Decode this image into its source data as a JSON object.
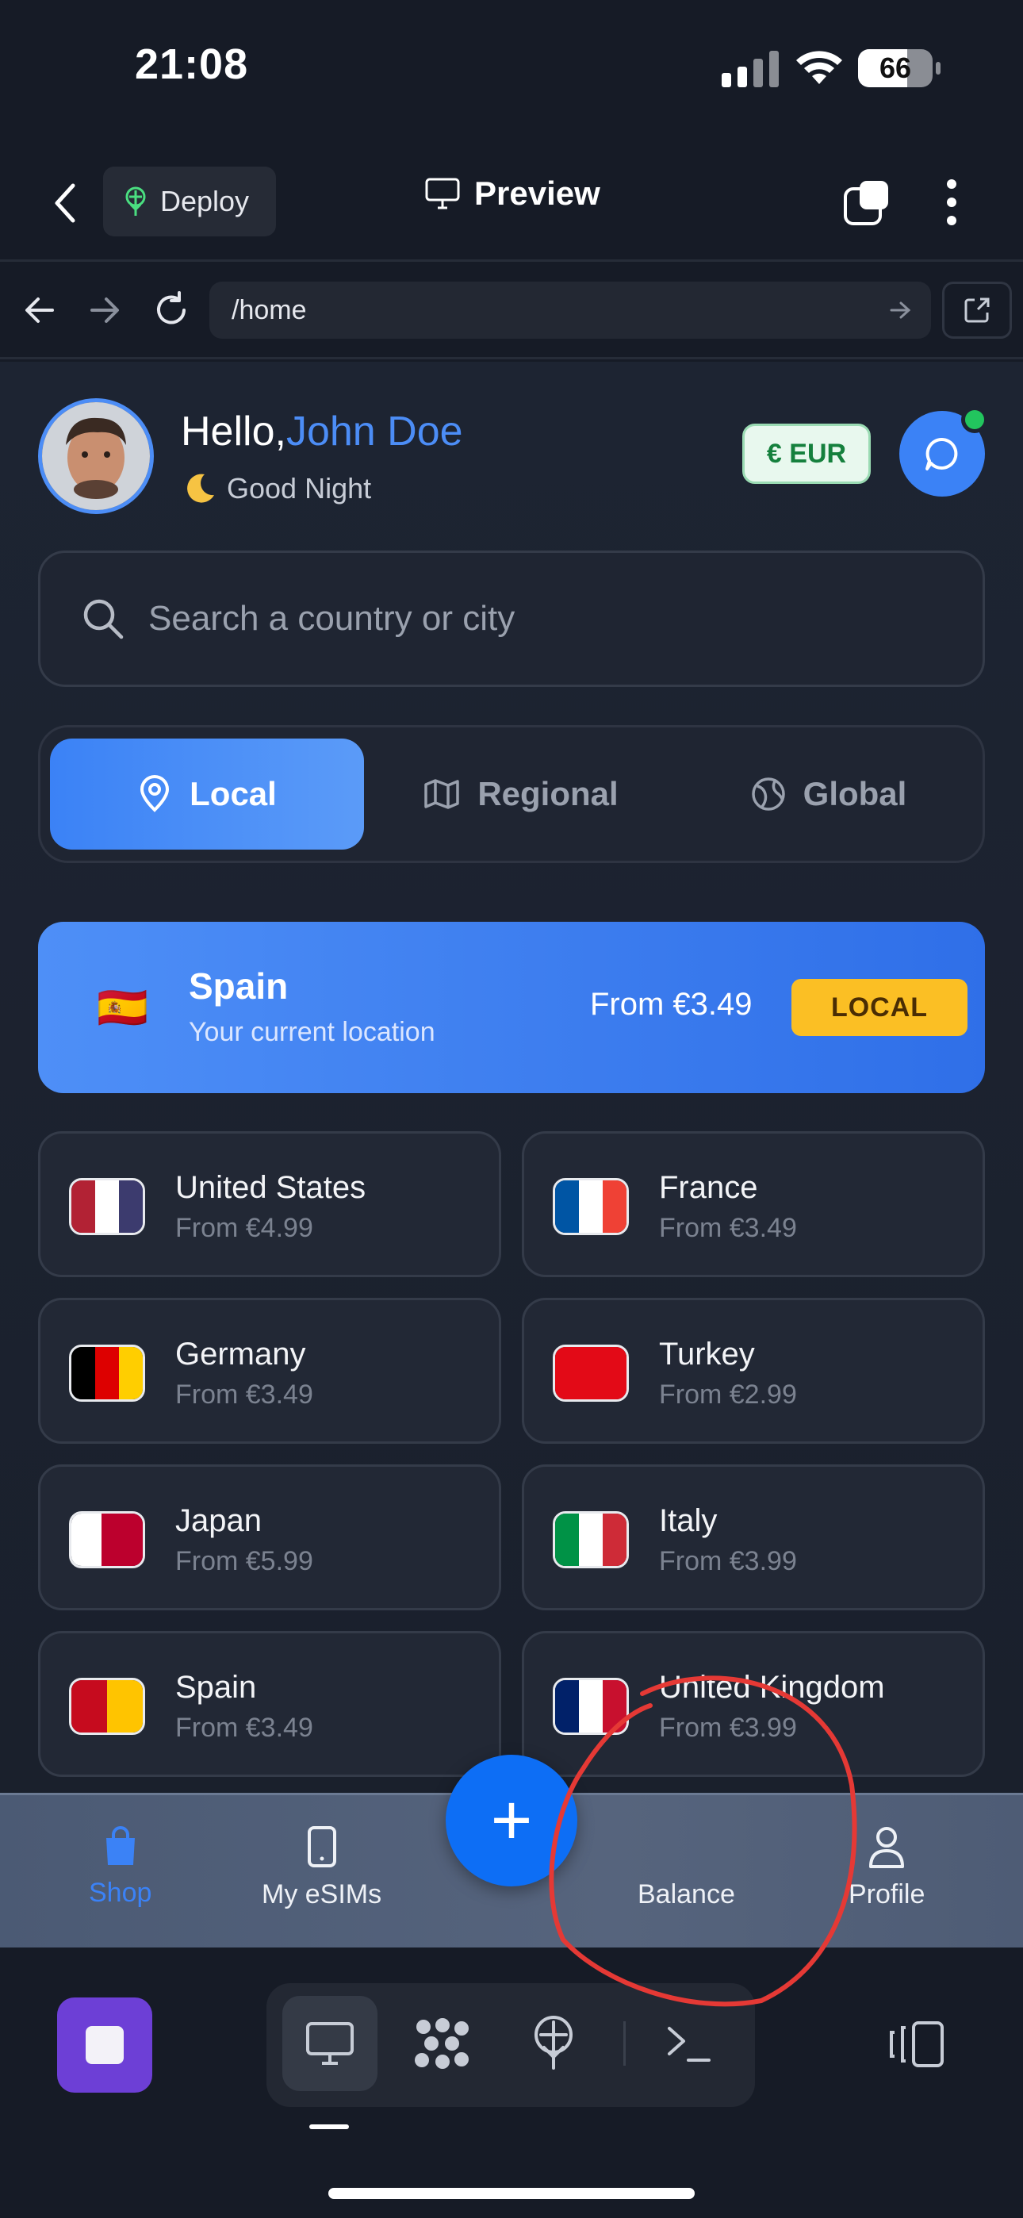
{
  "status_bar": {
    "time": "21:08",
    "battery": "66"
  },
  "preview_header": {
    "deploy_label": "Deploy",
    "title": "Preview"
  },
  "url_bar": {
    "url": "/home"
  },
  "greeting": {
    "hello": "Hello,",
    "name": "John Doe",
    "subtitle": "Good Night"
  },
  "currency_badge": "€ EUR",
  "search": {
    "placeholder": "Search a country or city"
  },
  "tabs": [
    {
      "label": "Local",
      "active": true
    },
    {
      "label": "Regional",
      "active": false
    },
    {
      "label": "Global",
      "active": false
    }
  ],
  "hero": {
    "country": "Spain",
    "subtitle": "Your current location",
    "price": "From €3.49",
    "tag": "LOCAL",
    "flag": "🇪🇸"
  },
  "countries": [
    {
      "name": "United States",
      "price": "From €4.99",
      "flag_colors": [
        "#b22234",
        "#ffffff",
        "#3c3b6e"
      ]
    },
    {
      "name": "France",
      "price": "From €3.49",
      "flag_colors": [
        "#0055a4",
        "#ffffff",
        "#ef4135"
      ]
    },
    {
      "name": "Germany",
      "price": "From €3.49",
      "flag_colors": [
        "#000000",
        "#dd0000",
        "#ffce00"
      ]
    },
    {
      "name": "Turkey",
      "price": "From €2.99",
      "flag_colors": [
        "#e30a17",
        "#e30a17",
        "#e30a17"
      ]
    },
    {
      "name": "Japan",
      "price": "From €5.99",
      "flag_colors": [
        "#ffffff",
        "#ffffff",
        "#bc002d"
      ]
    },
    {
      "name": "Italy",
      "price": "From €3.99",
      "flag_colors": [
        "#009246",
        "#ffffff",
        "#ce2b37"
      ]
    },
    {
      "name": "Spain",
      "price": "From €3.49",
      "flag_colors": [
        "#c60b1e",
        "#ffc400",
        "#ffc400"
      ]
    },
    {
      "name": "United Kingdom",
      "price": "From €3.99",
      "flag_colors": [
        "#012169",
        "#ffffff",
        "#c8102e"
      ]
    }
  ],
  "bottom_nav": {
    "shop": "Shop",
    "my_esims": "My eSIMs",
    "add": "+",
    "balance": "Balance",
    "profile": "Profile"
  },
  "colors": {
    "accent": "#3b82f6",
    "background": "#1d2432",
    "annotation": "#e53935",
    "local_tag": "#fbbf24"
  }
}
